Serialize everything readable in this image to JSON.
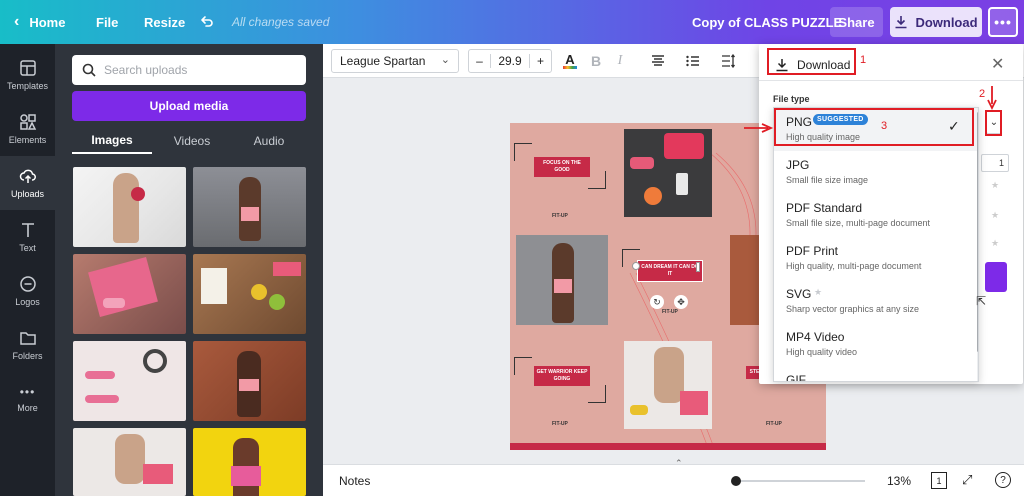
{
  "topbar": {
    "home": "Home",
    "file": "File",
    "resize": "Resize",
    "saved_status": "All changes saved",
    "doc_title": "Copy of CLASS PUZZLE",
    "share": "Share",
    "download": "Download"
  },
  "rail": {
    "items": [
      {
        "label": "Templates"
      },
      {
        "label": "Elements"
      },
      {
        "label": "Uploads"
      },
      {
        "label": "Text"
      },
      {
        "label": "Logos"
      },
      {
        "label": "Folders"
      },
      {
        "label": "More"
      }
    ]
  },
  "panel": {
    "search_placeholder": "Search uploads",
    "upload_button": "Upload media",
    "tabs": [
      "Images",
      "Videos",
      "Audio"
    ]
  },
  "toolbar": {
    "font": "League Spartan",
    "font_size": "29.9",
    "minus": "–",
    "plus": "+"
  },
  "design": {
    "banners": [
      "FOCUS ON THE GOOD",
      "CAN DREAM IT CAN DO IT",
      "GET WARRIOR KEEP GOING",
      "STEP BY DAY"
    ],
    "brand": "FIT-UP"
  },
  "bottombar": {
    "notes": "Notes",
    "zoom": "13%",
    "page_count": "1"
  },
  "download_panel": {
    "header": "Download",
    "file_type_label": "File type",
    "suggested_badge": "SUGGESTED",
    "file_types": [
      {
        "name": "PNG",
        "desc": "High quality image"
      },
      {
        "name": "JPG",
        "desc": "Small file size image"
      },
      {
        "name": "PDF Standard",
        "desc": "Small file size, multi-page document"
      },
      {
        "name": "PDF Print",
        "desc": "High quality, multi-page document"
      },
      {
        "name": "SVG",
        "desc": "Sharp vector graphics at any size"
      },
      {
        "name": "MP4 Video",
        "desc": "High quality video"
      },
      {
        "name": "GIF",
        "desc": ""
      }
    ],
    "side_value": "1"
  },
  "annotations": {
    "n1": "1",
    "n2": "2",
    "n3": "3"
  },
  "colors": {
    "accent_purple": "#7d2ae8",
    "annotation_red": "#e01c24",
    "badge_blue": "#2d82d8",
    "canvas_pink": "#dfa9a0",
    "banner_red": "#c62a47"
  }
}
